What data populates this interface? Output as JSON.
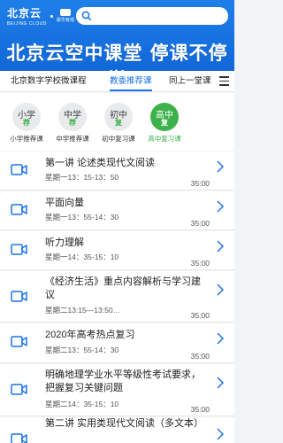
{
  "header": {
    "logo_main": "北京云",
    "logo_sub": "BEIJING CLOUD",
    "logo2_text": "歌华有线",
    "banner": "北京云空中课堂 停课不停学",
    "search_placeholder": ""
  },
  "tabs": [
    {
      "label": "北京数字学校微课程"
    },
    {
      "label": "教委推荐课"
    },
    {
      "label": "同上一堂课"
    }
  ],
  "categories": [
    {
      "line1": "小学",
      "line2": "荐",
      "label": "小学推荐课"
    },
    {
      "line1": "中学",
      "line2": "荐",
      "label": "中学推荐课"
    },
    {
      "line1": "初中",
      "line2": "复",
      "label": "初中复习课"
    },
    {
      "line1": "高中",
      "line2": "复",
      "label": "高中复习课"
    }
  ],
  "active_category": "高中复习课",
  "lessons": [
    {
      "title": "第一讲 论述类现代文阅读",
      "time": "星期一13：15-13：50",
      "duration": "35:00"
    },
    {
      "title": "平面向量",
      "time": "星期一13：55-14：30",
      "duration": "35:00"
    },
    {
      "title": "听力理解",
      "time": "星期一14：35-15：10",
      "duration": "35:00"
    },
    {
      "title": "《经济生活》重点内容解析与学习建议",
      "time": "星期二13:15—13:50…",
      "duration": "35:00"
    },
    {
      "title": "2020年高考热点复习",
      "time": "星期二13：55-14：30",
      "duration": "35:00"
    },
    {
      "title": "明确地理学业水平等级性考试要求，把握复习关键问题",
      "time": "星期二14：35-15：10",
      "duration": "35:00"
    },
    {
      "title": "第二讲 实用类现代文阅读（多文本）",
      "time": "",
      "duration": ""
    }
  ],
  "colors": {
    "brand_blue": "#1a73e8",
    "accent_green": "#3cb24a"
  }
}
